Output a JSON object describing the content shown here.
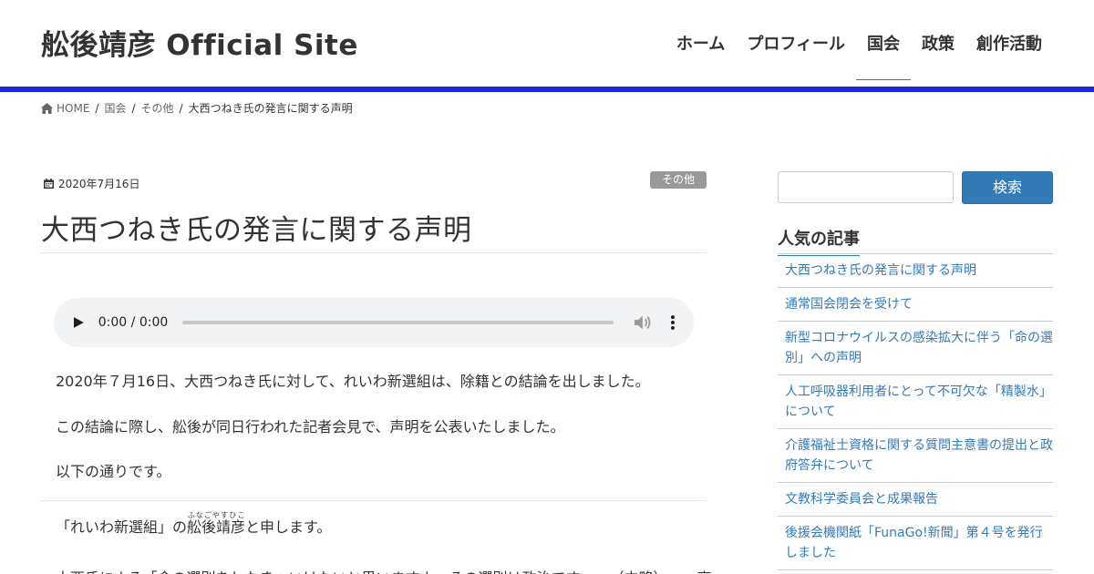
{
  "header": {
    "site_title": "舩後靖彦 Official Site",
    "nav": [
      {
        "label": "ホーム"
      },
      {
        "label": "プロフィール"
      },
      {
        "label": "国会"
      },
      {
        "label": "政策"
      },
      {
        "label": "創作活動"
      }
    ],
    "accent_bar_color": "#1c2be0"
  },
  "breadcrumb": {
    "home": "HOME",
    "level1": "国会",
    "level2": "その他",
    "current": "大西つねき氏の発言に関する声明"
  },
  "article": {
    "date": "2020年7月16日",
    "category": "その他",
    "title": "大西つねき氏の発言に関する声明",
    "audio_time": "0:00 / 0:00",
    "paragraphs": [
      "2020年７月16日、大西つねき氏に対して、れいわ新選組は、除籍との結論を出しました。",
      "この結論に際し、舩後が同日行われた記者会見で、声明を公表いたしました。",
      "以下の通りです。"
    ],
    "quote_before": "「れいわ新選組」の",
    "quote_name": "舩後靖彦",
    "quote_ruby": "ふなごやすひこ",
    "quote_after": "と申します。",
    "cut_line": "大西氏による「命の選別をしなきゃいけないと思いますよ、その選別は政治です……（中略）……高"
  },
  "sidebar": {
    "search_button": "検索",
    "popular_title": "人気の記事",
    "popular_items": [
      {
        "label": "大西つねき氏の発言に関する声明"
      },
      {
        "label": "通常国会閉会を受けて"
      },
      {
        "label": "新型コロナウイルスの感染拡大に伴う「命の選別」への声明"
      },
      {
        "label": "人工呼吸器利用者にとって不可欠な「精製水」について"
      },
      {
        "label": "介護福祉士資格に関する質問主意書の提出と政府答弁について"
      },
      {
        "label": "文教科学委員会と成果報告"
      },
      {
        "label": "後援会機関紙「FunaGo!新聞」第４号を発行しました"
      }
    ],
    "link_color": "#337ab7"
  }
}
